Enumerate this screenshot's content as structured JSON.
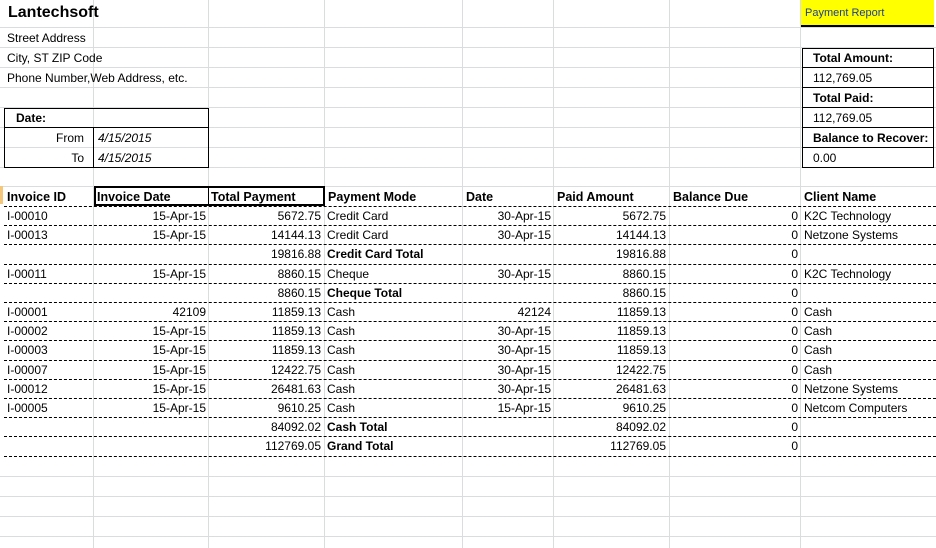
{
  "company": {
    "name": "Lantechsoft",
    "street": "Street Address",
    "city": "City, ST  ZIP Code",
    "contact": "Phone Number,Web Address, etc."
  },
  "date_box": {
    "label": "Date:",
    "from_label": "From",
    "from_value": "4/15/2015",
    "to_label": "To",
    "to_value": "4/15/2015"
  },
  "report": {
    "title": "Payment Report",
    "total_amount_label": "Total Amount:",
    "total_amount": "112,769.05",
    "total_paid_label": "Total Paid:",
    "total_paid": "112,769.05",
    "balance_label": "Balance to Recover:",
    "balance": "0.00"
  },
  "table": {
    "headers": [
      "Invoice ID",
      "Invoice Date",
      "Total Payment",
      "Payment Mode",
      "Date",
      "Paid Amount",
      "Balance Due",
      "Client Name"
    ],
    "rows": [
      {
        "id": "I-00010",
        "inv_date": "15-Apr-15",
        "total": "5672.75",
        "mode": "Credit Card",
        "date": "30-Apr-15",
        "paid": "5672.75",
        "balance": "0",
        "client": "K2C Technology"
      },
      {
        "id": "I-00013",
        "inv_date": "15-Apr-15",
        "total": "14144.13",
        "mode": "Credit Card",
        "date": "30-Apr-15",
        "paid": "14144.13",
        "balance": "0",
        "client": "Netzone Systems"
      },
      {
        "id": "",
        "inv_date": "",
        "total": "19816.88",
        "mode": "Credit Card Total",
        "date": "",
        "paid": "19816.88",
        "balance": "0",
        "client": "",
        "subtotal": true
      },
      {
        "id": "I-00011",
        "inv_date": "15-Apr-15",
        "total": "8860.15",
        "mode": "Cheque",
        "date": "30-Apr-15",
        "paid": "8860.15",
        "balance": "0",
        "client": "K2C Technology"
      },
      {
        "id": "",
        "inv_date": "",
        "total": "8860.15",
        "mode": "Cheque Total",
        "date": "",
        "paid": "8860.15",
        "balance": "0",
        "client": "",
        "subtotal": true
      },
      {
        "id": "I-00001",
        "inv_date": "42109",
        "total": "11859.13",
        "mode": "Cash",
        "date": "42124",
        "paid": "11859.13",
        "balance": "0",
        "client": "Cash"
      },
      {
        "id": "I-00002",
        "inv_date": "15-Apr-15",
        "total": "11859.13",
        "mode": "Cash",
        "date": "30-Apr-15",
        "paid": "11859.13",
        "balance": "0",
        "client": "Cash"
      },
      {
        "id": "I-00003",
        "inv_date": "15-Apr-15",
        "total": "11859.13",
        "mode": "Cash",
        "date": "30-Apr-15",
        "paid": "11859.13",
        "balance": "0",
        "client": "Cash"
      },
      {
        "id": "I-00007",
        "inv_date": "15-Apr-15",
        "total": "12422.75",
        "mode": "Cash",
        "date": "30-Apr-15",
        "paid": "12422.75",
        "balance": "0",
        "client": "Cash"
      },
      {
        "id": "I-00012",
        "inv_date": "15-Apr-15",
        "total": "26481.63",
        "mode": "Cash",
        "date": "30-Apr-15",
        "paid": "26481.63",
        "balance": "0",
        "client": "Netzone Systems"
      },
      {
        "id": "I-00005",
        "inv_date": "15-Apr-15",
        "total": "9610.25",
        "mode": "Cash",
        "date": "15-Apr-15",
        "paid": "9610.25",
        "balance": "0",
        "client": "Netcom Computers"
      },
      {
        "id": "",
        "inv_date": "",
        "total": "84092.02",
        "mode": "Cash Total",
        "date": "",
        "paid": "84092.02",
        "balance": "0",
        "client": "",
        "subtotal": true
      },
      {
        "id": "",
        "inv_date": "",
        "total": "112769.05",
        "mode": "Grand Total",
        "date": "",
        "paid": "112769.05",
        "balance": "0",
        "client": "",
        "subtotal": true
      }
    ]
  },
  "colors": {
    "gridline": "#dadcdd",
    "highlight": "#ffff00",
    "report_title": "#1f3f8f"
  }
}
